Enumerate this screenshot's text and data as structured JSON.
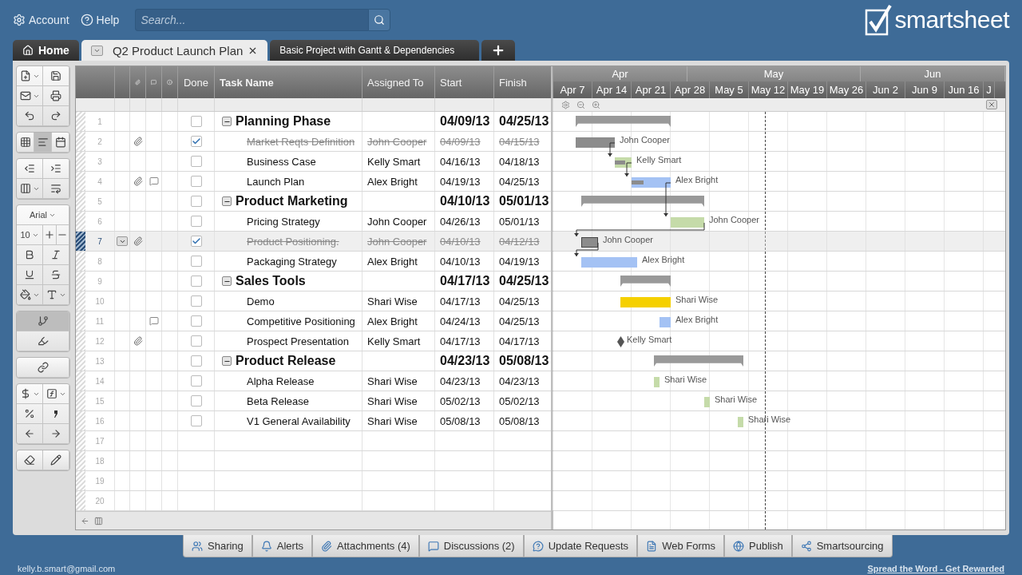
{
  "header": {
    "account": "Account",
    "help": "Help",
    "search_placeholder": "Search...",
    "logo": "smartsheet"
  },
  "tabs": [
    {
      "kind": "home",
      "label": "Home",
      "selected": false
    },
    {
      "kind": "sheet",
      "label": "Q2 Product Launch Plan",
      "selected": true
    },
    {
      "kind": "sheet",
      "label": "Basic Project with Gantt & Dependencies",
      "selected": false
    },
    {
      "kind": "add",
      "selected": false
    }
  ],
  "toolbar": {
    "font": "Arial",
    "font_size": "10",
    "views": [
      {
        "selected": false
      },
      {
        "selected": true
      },
      {
        "selected": false
      }
    ]
  },
  "grid": {
    "columns": [
      "Done",
      "Task Name",
      "Assigned To",
      "Start",
      "Finish"
    ],
    "rows": [
      {
        "number": "1",
        "kind": "summary",
        "task": "Planning Phase",
        "start": "04/09/13",
        "finish": "04/25/13",
        "done": false,
        "expanded": true,
        "attachment": false,
        "comment": false,
        "selected": false,
        "color": "#999999"
      },
      {
        "number": "2",
        "kind": "task",
        "task": "Market Reqts Definition",
        "assigned": "John Cooper",
        "bar_label": "John Cooper",
        "start": "04/09/13",
        "finish": "04/15/13",
        "done": true,
        "attachment": true,
        "comment": false,
        "selected": false,
        "color": "#8c8c8c",
        "linked": false
      },
      {
        "number": "3",
        "kind": "task",
        "task": "Business Case",
        "assigned": "Kelly Smart",
        "bar_label": "Kelly Smart",
        "start": "04/16/13",
        "finish": "04/18/13",
        "done": false,
        "attachment": false,
        "comment": false,
        "selected": false,
        "color": "#c5dba9",
        "level": 0.6,
        "linked": true
      },
      {
        "number": "4",
        "kind": "task",
        "task": "Launch Plan",
        "assigned": "Alex Bright",
        "bar_label": "Alex Bright",
        "start": "04/19/13",
        "finish": "04/25/13",
        "done": false,
        "attachment": true,
        "comment": true,
        "selected": false,
        "color": "#a4c2f4",
        "level": 0.3,
        "linked": true
      },
      {
        "number": "5",
        "kind": "summary",
        "task": "Product Marketing",
        "start": "04/10/13",
        "finish": "05/01/13",
        "done": false,
        "expanded": true,
        "attachment": false,
        "comment": false,
        "selected": false,
        "color": "#999999"
      },
      {
        "number": "6",
        "kind": "task",
        "task": "Pricing Strategy",
        "assigned": "John Cooper",
        "bar_label": "John Cooper",
        "start": "04/26/13",
        "finish": "05/01/13",
        "done": false,
        "attachment": false,
        "comment": false,
        "selected": false,
        "color": "#c5dba9",
        "linked": true
      },
      {
        "number": "7",
        "kind": "task",
        "task": "Product Positioning.",
        "assigned": "John Cooper",
        "bar_label": "John Cooper",
        "start": "04/10/13",
        "finish": "04/12/13",
        "done": true,
        "attachment": true,
        "comment": false,
        "selected": true,
        "color": "#8c8c8c",
        "linked": true
      },
      {
        "number": "8",
        "kind": "task",
        "task": "Packaging Strategy",
        "assigned": "Alex Bright",
        "bar_label": "Alex Bright",
        "start": "04/10/13",
        "finish": "04/19/13",
        "done": false,
        "attachment": false,
        "comment": false,
        "selected": false,
        "color": "#a4c2f4",
        "linked": true
      },
      {
        "number": "9",
        "kind": "summary",
        "task": "Sales Tools",
        "start": "04/17/13",
        "finish": "04/25/13",
        "done": false,
        "expanded": true,
        "attachment": false,
        "comment": false,
        "selected": false,
        "color": "#999999"
      },
      {
        "number": "10",
        "kind": "task",
        "task": "Demo",
        "assigned": "Shari Wise",
        "bar_label": "Shari Wise",
        "start": "04/17/13",
        "finish": "04/25/13",
        "done": false,
        "attachment": false,
        "comment": false,
        "selected": false,
        "color": "#f5d000",
        "linked": false
      },
      {
        "number": "11",
        "kind": "task",
        "task": "Competitive Positioning",
        "assigned": "Alex Bright",
        "bar_label": "Alex Bright",
        "start": "04/24/13",
        "finish": "04/25/13",
        "done": false,
        "attachment": false,
        "comment": true,
        "selected": false,
        "color": "#a4c2f4",
        "linked": false
      },
      {
        "number": "12",
        "kind": "milestone",
        "task": "Prospect Presentation",
        "assigned": "Kelly Smart",
        "bar_label": "Kelly Smart",
        "start": "04/17/13",
        "finish": "04/17/13",
        "done": false,
        "attachment": true,
        "comment": false,
        "selected": false,
        "color": "#555555",
        "linked": false
      },
      {
        "number": "13",
        "kind": "summary",
        "task": "Product Release",
        "start": "04/23/13",
        "finish": "05/08/13",
        "done": false,
        "expanded": true,
        "attachment": false,
        "comment": false,
        "selected": false,
        "color": "#999999"
      },
      {
        "number": "14",
        "kind": "task",
        "task": "Alpha Release",
        "assigned": "Shari Wise",
        "bar_label": "Shari Wise",
        "start": "04/23/13",
        "finish": "04/23/13",
        "done": false,
        "attachment": false,
        "comment": false,
        "selected": false,
        "color": "#c5dba9",
        "linked": false
      },
      {
        "number": "15",
        "kind": "task",
        "task": "Beta Release",
        "assigned": "Shari Wise",
        "bar_label": "Shari Wise",
        "start": "05/02/13",
        "finish": "05/02/13",
        "done": false,
        "attachment": false,
        "comment": false,
        "selected": false,
        "color": "#c5dba9",
        "linked": false
      },
      {
        "number": "16",
        "kind": "task",
        "task": "V1 General Availability",
        "assigned": "Shari Wise",
        "bar_label": "Shari Wise",
        "start": "05/08/13",
        "finish": "05/08/13",
        "done": false,
        "attachment": false,
        "comment": false,
        "selected": false,
        "color": "#c5dba9",
        "linked": false
      }
    ],
    "empty_rows": [
      "17",
      "18",
      "19",
      "20"
    ]
  },
  "gantt": {
    "months": [
      "Apr",
      "May",
      "Jun"
    ],
    "weeks": [
      "Apr 7",
      "Apr 14",
      "Apr 21",
      "Apr 28",
      "May 5",
      "May 12",
      "May 19",
      "May 26",
      "Jun 2",
      "Jun 9",
      "Jun 16",
      "J"
    ]
  },
  "bottom_tabs": [
    "Sharing",
    "Alerts",
    "Attachments (4)",
    "Discussions (2)",
    "Update Requests",
    "Web Forms",
    "Publish",
    "Smartsourcing"
  ],
  "footer": {
    "email": "kelly.b.smart@gmail.com",
    "link": "Spread the Word - Get Rewarded"
  }
}
